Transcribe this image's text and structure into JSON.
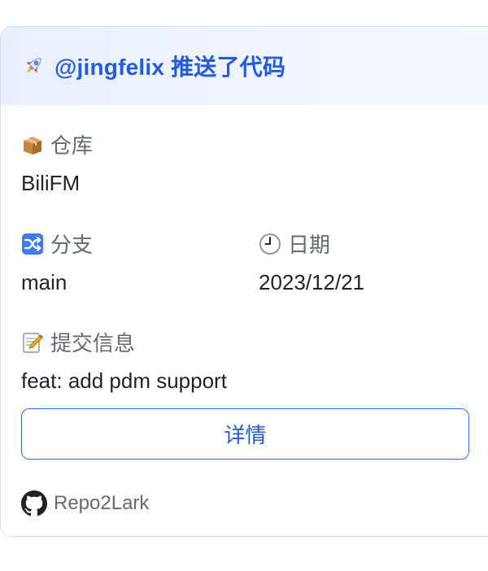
{
  "header": {
    "title": "@jingfelix 推送了代码",
    "icon": "rocket-icon"
  },
  "repo": {
    "label": "仓库",
    "icon": "package-icon",
    "value": "BiliFM"
  },
  "branch": {
    "label": "分支",
    "icon": "shuffle-icon",
    "value": "main"
  },
  "date": {
    "label": "日期",
    "icon": "clock-icon",
    "value": "2023/12/21"
  },
  "commit": {
    "label": "提交信息",
    "icon": "memo-icon",
    "value": "feat: add pdm support"
  },
  "details_button": {
    "label": "详情"
  },
  "footer": {
    "icon": "github-icon",
    "text": "Repo2Lark"
  },
  "colors": {
    "accent": "#245bdb",
    "button_border": "#3370ff",
    "header_bg": "#e8efff",
    "label": "#646a73",
    "text": "#1f2329"
  }
}
